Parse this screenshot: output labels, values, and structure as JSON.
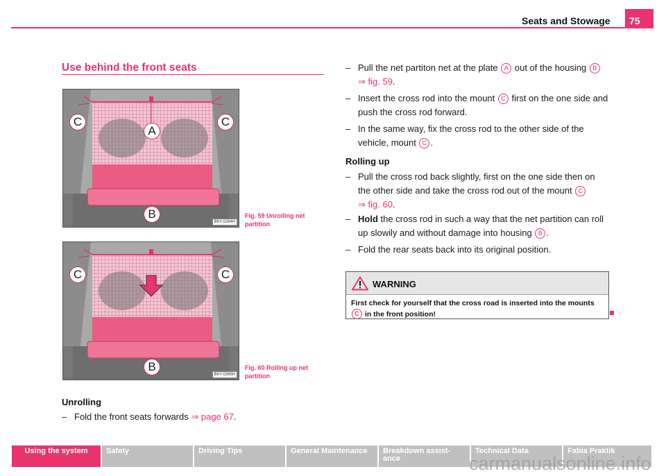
{
  "header": {
    "title": "Seats and Stowage",
    "page_number": "75"
  },
  "section": {
    "title": "Use behind the front seats"
  },
  "figures": [
    {
      "code": "B6Y-0264H",
      "caption": "Fig. 59   Unrolling net partition",
      "labels": [
        "A",
        "B",
        "C",
        "C"
      ]
    },
    {
      "code": "B6Y-0266H",
      "caption": "Fig. 60   Rolling up net partition",
      "labels": [
        "B",
        "C",
        "C"
      ]
    }
  ],
  "left_column": {
    "heading": "Unrolling",
    "step1": {
      "dash": "–",
      "text": "Fold the front seats forwards ",
      "link": "⇒ page 67",
      "tail": "."
    }
  },
  "right_column": {
    "step1": {
      "dash": "–",
      "text_a": "Pull the net partiton net at the plate ",
      "callout_a": "A",
      "text_b": " out of the housing ",
      "callout_b": "B",
      "link": "⇒ fig. 59",
      "tail": "."
    },
    "step2": {
      "dash": "–",
      "text_a": "Insert the cross rod into the mount ",
      "callout": "C",
      "text_b": " first on the one side and push the cross rod forward."
    },
    "step3": {
      "dash": "–",
      "text_a": "In the same way, fix the cross rod to the other side of the vehicle, mount ",
      "callout": "C",
      "tail": "."
    },
    "rolling_heading": "Rolling up",
    "step4": {
      "dash": "–",
      "text_a": "Pull the cross rod back slightly, first on the one side then on the other side and take the cross rod out of the mount ",
      "callout": "C",
      "link": "⇒ fig. 60",
      "tail": "."
    },
    "step5": {
      "dash": "–",
      "bold": "Hold",
      "text_a": " the cross rod in such a way that the net partition can roll up slowily and without damage into housing ",
      "callout": "B",
      "tail": "."
    },
    "step6": {
      "dash": "–",
      "text": "Fold the rear seats back into its original position."
    }
  },
  "warning": {
    "label": "WARNING",
    "text_a": "First check for yourself that the cross road is inserted into the mounts ",
    "callout": "C",
    "text_b": " in the front position!"
  },
  "bottom_nav": {
    "tabs": [
      {
        "label": "Using the system",
        "active": true
      },
      {
        "label": "Safety"
      },
      {
        "label": "Driving Tips"
      },
      {
        "label": "General Maintenance"
      },
      {
        "label": "Breakdown assist-ance"
      },
      {
        "label": "Technical Data"
      },
      {
        "label": "Fabia Praktik"
      }
    ]
  },
  "watermark": "carmanualsonline.info",
  "colors": {
    "accent": "#e8336e",
    "tab_inactive": "#c0c0c0"
  }
}
